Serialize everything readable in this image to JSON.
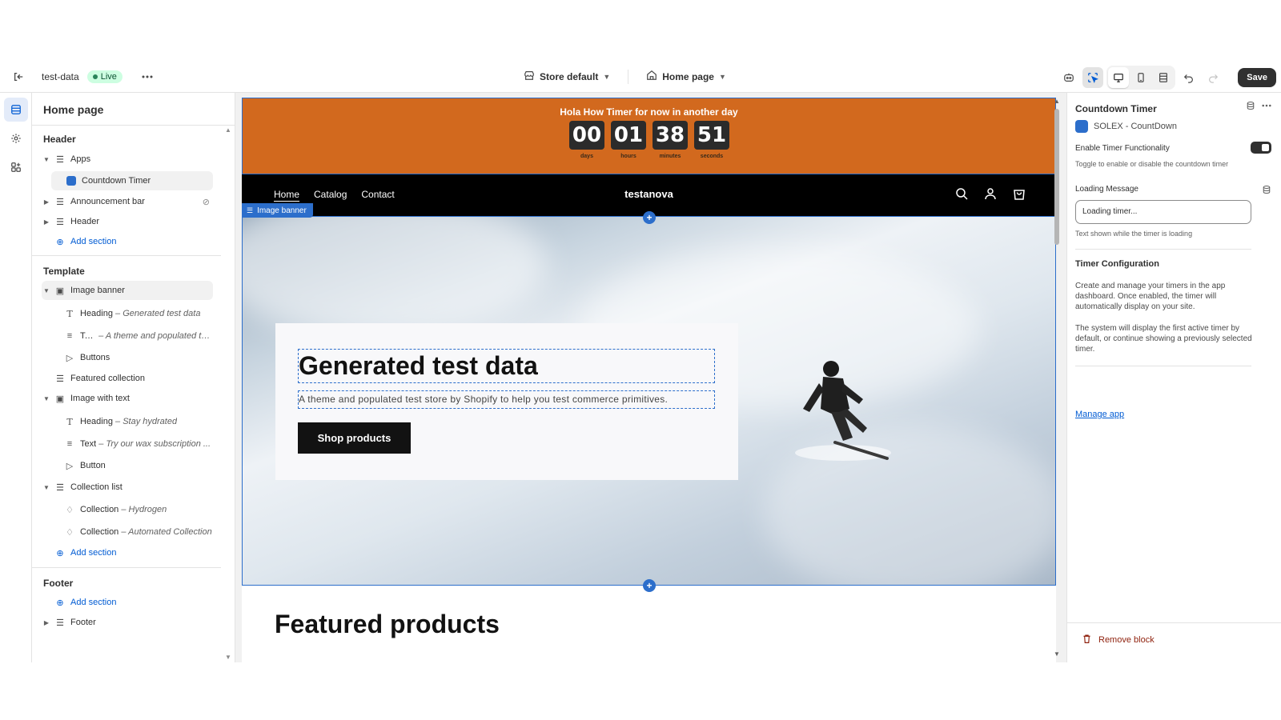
{
  "topbar": {
    "store_name": "test-data",
    "status_badge": "Live",
    "theme_select": "Store default",
    "page_select": "Home page",
    "save_label": "Save"
  },
  "sidebar": {
    "title": "Home page",
    "groups": {
      "header_title": "Header",
      "template_title": "Template",
      "footer_title": "Footer"
    },
    "items": {
      "apps": "Apps",
      "countdown_timer": "Countdown Timer",
      "announcement_bar": "Announcement bar",
      "header": "Header",
      "add_section_1": "Add section",
      "image_banner": "Image banner",
      "heading_1": "Heading",
      "heading_1_sub": "– Generated test data",
      "text_1": "Text",
      "text_1_sub": "– A theme and populated te...",
      "buttons": "Buttons",
      "featured_collection": "Featured collection",
      "image_with_text": "Image with text",
      "heading_2": "Heading",
      "heading_2_sub": "– Stay hydrated",
      "text_2": "Text",
      "text_2_sub": "– Try our wax subscription ...",
      "button": "Button",
      "collection_list": "Collection list",
      "collection_1": "Collection",
      "collection_1_sub": "– Hydrogen",
      "collection_2": "Collection",
      "collection_2_sub": "– Automated Collection",
      "add_section_2": "Add section",
      "add_section_3": "Add section",
      "footer": "Footer"
    }
  },
  "preview": {
    "announcement": {
      "title": "Hola How Timer for now in another day",
      "timer": [
        {
          "value": "00",
          "label": "days"
        },
        {
          "value": "01",
          "label": "hours"
        },
        {
          "value": "38",
          "label": "minutes"
        },
        {
          "value": "51",
          "label": "seconds"
        }
      ],
      "bg_color": "#d2691e"
    },
    "nav": {
      "links": [
        "Home",
        "Catalog",
        "Contact"
      ],
      "brand": "testanova"
    },
    "banner_tag": "Image banner",
    "hero": {
      "heading": "Generated test data",
      "text": "A theme and populated test store by Shopify to help you test commerce primitives.",
      "button": "Shop products"
    },
    "featured_heading": "Featured products"
  },
  "rpanel": {
    "title": "Countdown Timer",
    "app_name": "SOLEX - CountDown",
    "enable_label": "Enable Timer Functionality",
    "enable_help": "Toggle to enable or disable the countdown timer",
    "loading_label": "Loading Message",
    "loading_value": "Loading timer...",
    "loading_help": "Text shown while the timer is loading",
    "config_title": "Timer Configuration",
    "config_p1": "Create and manage your timers in the app dashboard. Once enabled, the timer will automatically display on your site.",
    "config_p2": "The system will display the first active timer by default, or continue showing a previously selected timer.",
    "manage_link": "Manage app",
    "remove_label": "Remove block"
  },
  "colors": {
    "accent": "#2c6ecb",
    "announcement": "#d2691e",
    "live": "#cdfee1"
  }
}
